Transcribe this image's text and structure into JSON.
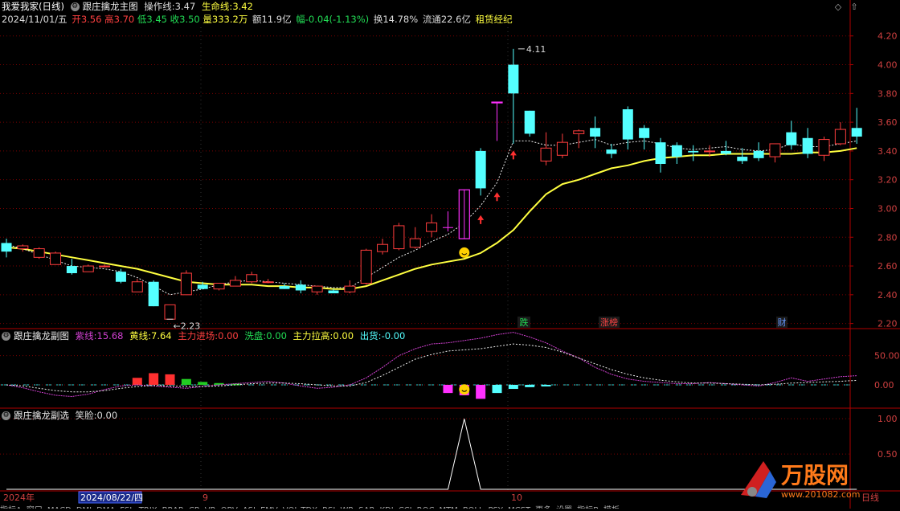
{
  "main_panel": {
    "title": "我爱我家(日线)",
    "indicator_name": "跟庄擒龙主图",
    "op_line_label": "操作线:",
    "op_line_value": "3.47",
    "life_line_label": "生命线:",
    "life_line_value": "3.42",
    "date": "2024/11/01/五",
    "open_label": "开",
    "open_value": "3.56",
    "high_label": "高",
    "high_value": "3.70",
    "low_label": "低",
    "low_value": "3.45",
    "close_label": "收",
    "close_value": "3.50",
    "volume_label": "量",
    "volume_value": "333.2万",
    "amount_label": "额",
    "amount_value": "11.9亿",
    "change_label": "幅",
    "change_value": "-0.04(-1.13%)",
    "turnover_label": "换",
    "turnover_value": "14.78%",
    "float_label": "流通",
    "float_value": "22.6亿",
    "sector": "租赁经纪",
    "y_ticks": [
      "4.20",
      "4.00",
      "3.80",
      "3.60",
      "3.40",
      "3.20",
      "3.00",
      "2.80",
      "2.60",
      "2.40",
      "2.20"
    ],
    "max_label": "4.11",
    "min_label": "2.23",
    "markers": [
      {
        "text": "跌",
        "color": "#22dd55"
      },
      {
        "text": "涨榜",
        "color": "#ff4444"
      },
      {
        "text": "财",
        "color": "#6699ff"
      }
    ]
  },
  "sub_panel_1": {
    "name": "跟庄擒龙副图",
    "purple_label": "紫线:",
    "purple_value": "15.68",
    "yellow_label": "黄线:",
    "yellow_value": "7.64",
    "main_in_label": "主力进场:",
    "main_in_value": "0.00",
    "wash_label": "洗盘:",
    "wash_value": "0.00",
    "main_pull_label": "主力拉高:",
    "main_pull_value": "0.00",
    "ship_label": "出货:",
    "ship_value": "-0.00",
    "y_ticks": [
      "50.00",
      "0.00"
    ]
  },
  "sub_panel_2": {
    "name": "跟庄擒龙副选",
    "smile_label": "笑脸:",
    "smile_value": "0.00",
    "y_ticks": [
      "1.00",
      "0.50"
    ]
  },
  "time_axis": {
    "year": "2024年",
    "cursor_date": "2024/08/22/四",
    "month_9": "9",
    "month_10": "10",
    "right_label": "日线"
  },
  "bottom_tabs": [
    "指标A",
    "窗口",
    "MACD",
    "DMI",
    "DMA",
    "FSL",
    "TRIX",
    "BRAR",
    "CR",
    "VR",
    "OBV",
    "ASI",
    "EMV",
    "VOL-TDX",
    "RSI",
    "WR",
    "SAR",
    "KDJ",
    "CCI",
    "ROC",
    "MTM",
    "BOLL",
    "PSY",
    "MCST",
    "更多",
    "设置",
    "指标B",
    "模板"
  ],
  "watermark": {
    "brand": "万股网",
    "url": "www.201082.com"
  },
  "colors": {
    "up": "#ff3d3d",
    "down": "#54ffff",
    "yellow": "#ffff40",
    "purple": "#d040d0",
    "grid": "#7a0000",
    "magenta": "#ff30ff",
    "axis": "#b00000",
    "tick_text": "#d04040"
  },
  "chart_data": {
    "type": "candlestick",
    "price_range": [
      2.17,
      4.26
    ],
    "candles": [
      {
        "o": 2.76,
        "h": 2.79,
        "l": 2.66,
        "c": 2.7
      },
      {
        "o": 2.72,
        "h": 2.75,
        "l": 2.7,
        "c": 2.74
      },
      {
        "o": 2.66,
        "h": 2.73,
        "l": 2.65,
        "c": 2.72
      },
      {
        "o": 2.61,
        "h": 2.7,
        "l": 2.61,
        "c": 2.69
      },
      {
        "o": 2.6,
        "h": 2.65,
        "l": 2.54,
        "c": 2.55
      },
      {
        "o": 2.56,
        "h": 2.61,
        "l": 2.56,
        "c": 2.6
      },
      {
        "o": 2.6,
        "h": 2.61,
        "l": 2.59,
        "c": 2.6
      },
      {
        "o": 2.56,
        "h": 2.58,
        "l": 2.48,
        "c": 2.49
      },
      {
        "o": 2.42,
        "h": 2.51,
        "l": 2.42,
        "c": 2.49
      },
      {
        "o": 2.49,
        "h": 2.5,
        "l": 2.32,
        "c": 2.32
      },
      {
        "o": 2.23,
        "h": 2.33,
        "l": 2.23,
        "c": 2.33
      },
      {
        "o": 2.4,
        "h": 2.57,
        "l": 2.4,
        "c": 2.55
      },
      {
        "o": 2.47,
        "h": 2.49,
        "l": 2.44,
        "c": 2.44
      },
      {
        "o": 2.44,
        "h": 2.48,
        "l": 2.43,
        "c": 2.48
      },
      {
        "o": 2.46,
        "h": 2.53,
        "l": 2.46,
        "c": 2.5
      },
      {
        "o": 2.49,
        "h": 2.56,
        "l": 2.48,
        "c": 2.54
      },
      {
        "o": 2.49,
        "h": 2.51,
        "l": 2.48,
        "c": 2.49
      },
      {
        "o": 2.46,
        "h": 2.48,
        "l": 2.44,
        "c": 2.44
      },
      {
        "o": 2.47,
        "h": 2.5,
        "l": 2.41,
        "c": 2.43
      },
      {
        "o": 2.42,
        "h": 2.46,
        "l": 2.4,
        "c": 2.46
      },
      {
        "o": 2.43,
        "h": 2.44,
        "l": 2.41,
        "c": 2.41
      },
      {
        "o": 2.42,
        "h": 2.5,
        "l": 2.41,
        "c": 2.46
      },
      {
        "o": 2.48,
        "h": 2.72,
        "l": 2.47,
        "c": 2.71
      },
      {
        "o": 2.7,
        "h": 2.79,
        "l": 2.68,
        "c": 2.75
      },
      {
        "o": 2.72,
        "h": 2.9,
        "l": 2.71,
        "c": 2.88
      },
      {
        "o": 2.73,
        "h": 2.87,
        "l": 2.72,
        "c": 2.79
      },
      {
        "o": 2.84,
        "h": 2.96,
        "l": 2.8,
        "c": 2.9
      },
      {
        "o": 2.87,
        "h": 2.98,
        "l": 2.84,
        "c": 2.87
      },
      {
        "o": 2.79,
        "h": 3.13,
        "l": 2.79,
        "c": 3.13
      },
      {
        "o": 3.4,
        "h": 3.42,
        "l": 3.09,
        "c": 3.14
      },
      {
        "o": 3.74,
        "h": 3.74,
        "l": 3.47,
        "c": 3.74
      },
      {
        "o": 4.0,
        "h": 4.11,
        "l": 3.45,
        "c": 3.8
      },
      {
        "o": 3.68,
        "h": 3.68,
        "l": 3.5,
        "c": 3.52
      },
      {
        "o": 3.33,
        "h": 3.53,
        "l": 3.3,
        "c": 3.42
      },
      {
        "o": 3.37,
        "h": 3.52,
        "l": 3.35,
        "c": 3.46
      },
      {
        "o": 3.52,
        "h": 3.55,
        "l": 3.42,
        "c": 3.54
      },
      {
        "o": 3.56,
        "h": 3.64,
        "l": 3.42,
        "c": 3.5
      },
      {
        "o": 3.41,
        "h": 3.45,
        "l": 3.35,
        "c": 3.38
      },
      {
        "o": 3.69,
        "h": 3.71,
        "l": 3.41,
        "c": 3.48
      },
      {
        "o": 3.56,
        "h": 3.58,
        "l": 3.41,
        "c": 3.49
      },
      {
        "o": 3.46,
        "h": 3.49,
        "l": 3.25,
        "c": 3.31
      },
      {
        "o": 3.44,
        "h": 3.46,
        "l": 3.31,
        "c": 3.36
      },
      {
        "o": 3.4,
        "h": 3.44,
        "l": 3.33,
        "c": 3.39
      },
      {
        "o": 3.4,
        "h": 3.44,
        "l": 3.36,
        "c": 3.4
      },
      {
        "o": 3.4,
        "h": 3.47,
        "l": 3.37,
        "c": 3.38
      },
      {
        "o": 3.36,
        "h": 3.42,
        "l": 3.31,
        "c": 3.33
      },
      {
        "o": 3.4,
        "h": 3.46,
        "l": 3.33,
        "c": 3.35
      },
      {
        "o": 3.36,
        "h": 3.45,
        "l": 3.32,
        "c": 3.45
      },
      {
        "o": 3.53,
        "h": 3.61,
        "l": 3.41,
        "c": 3.44
      },
      {
        "o": 3.49,
        "h": 3.56,
        "l": 3.35,
        "c": 3.38
      },
      {
        "o": 3.37,
        "h": 3.5,
        "l": 3.33,
        "c": 3.48
      },
      {
        "o": 3.45,
        "h": 3.6,
        "l": 3.44,
        "c": 3.55
      },
      {
        "o": 3.56,
        "h": 3.7,
        "l": 3.45,
        "c": 3.5
      }
    ],
    "life_line": [
      2.73,
      2.72,
      2.7,
      2.68,
      2.66,
      2.64,
      2.62,
      2.6,
      2.58,
      2.55,
      2.52,
      2.49,
      2.48,
      2.47,
      2.47,
      2.47,
      2.46,
      2.46,
      2.45,
      2.45,
      2.44,
      2.44,
      2.46,
      2.5,
      2.54,
      2.58,
      2.61,
      2.63,
      2.65,
      2.69,
      2.76,
      2.85,
      2.98,
      3.1,
      3.17,
      3.2,
      3.24,
      3.28,
      3.3,
      3.33,
      3.35,
      3.36,
      3.37,
      3.37,
      3.38,
      3.38,
      3.38,
      3.38,
      3.38,
      3.39,
      3.39,
      3.4,
      3.42
    ],
    "op_line": [
      2.75,
      2.72,
      2.68,
      2.64,
      2.6,
      2.59,
      2.58,
      2.56,
      2.52,
      2.46,
      2.4,
      2.42,
      2.44,
      2.47,
      2.49,
      2.5,
      2.49,
      2.48,
      2.47,
      2.46,
      2.45,
      2.45,
      2.52,
      2.59,
      2.66,
      2.71,
      2.77,
      2.82,
      2.9,
      3.02,
      3.18,
      3.47,
      3.47,
      3.44,
      3.44,
      3.46,
      3.48,
      3.44,
      3.46,
      3.47,
      3.45,
      3.42,
      3.41,
      3.42,
      3.43,
      3.41,
      3.4,
      3.41,
      3.45,
      3.43,
      3.43,
      3.45,
      3.47
    ],
    "sub1_purple": [
      0,
      -5,
      -12,
      -18,
      -20,
      -16,
      -8,
      -2,
      0,
      -2,
      -4,
      -6,
      -3,
      0,
      2,
      4,
      6,
      3,
      -2,
      -6,
      -4,
      0,
      12,
      30,
      50,
      62,
      70,
      72,
      76,
      80,
      86,
      90,
      82,
      72,
      58,
      46,
      30,
      18,
      10,
      6,
      4,
      2,
      2,
      4,
      2,
      0,
      -2,
      4,
      12,
      6,
      10,
      14,
      15.68
    ],
    "sub1_yellow": [
      0,
      -2,
      -6,
      -10,
      -12,
      -12,
      -10,
      -6,
      -3,
      -1,
      -2,
      -3,
      -3,
      -2,
      0,
      2,
      3,
      3,
      2,
      0,
      -2,
      -2,
      4,
      16,
      30,
      44,
      52,
      58,
      60,
      62,
      66,
      70,
      68,
      64,
      56,
      46,
      36,
      26,
      18,
      12,
      8,
      5,
      3,
      3,
      2,
      1,
      0,
      1,
      3,
      4,
      5,
      6,
      7.64
    ],
    "sub1_bars": [
      {
        "i": 8,
        "v": 12,
        "c": "#ff3030"
      },
      {
        "i": 9,
        "v": 20,
        "c": "#ff3030"
      },
      {
        "i": 10,
        "v": 18,
        "c": "#ff3030"
      },
      {
        "i": 11,
        "v": 10,
        "c": "#22cc22"
      },
      {
        "i": 12,
        "v": 5,
        "c": "#22cc22"
      },
      {
        "i": 13,
        "v": 3,
        "c": "#22cc22"
      },
      {
        "i": 14,
        "v": 2,
        "c": "#22cc22"
      },
      {
        "i": 27,
        "v": -14,
        "c": "#ff30ff"
      },
      {
        "i": 28,
        "v": -18,
        "c": "#ff30ff"
      },
      {
        "i": 29,
        "v": -24,
        "c": "#ff30ff"
      },
      {
        "i": 30,
        "v": -14,
        "c": "#54ffff"
      },
      {
        "i": 31,
        "v": -7,
        "c": "#54ffff"
      },
      {
        "i": 32,
        "v": -4,
        "c": "#54ffff"
      },
      {
        "i": 33,
        "v": -2,
        "c": "#54ffff"
      }
    ],
    "sub2_signal": {
      "index": 28,
      "value": 1.0
    }
  }
}
